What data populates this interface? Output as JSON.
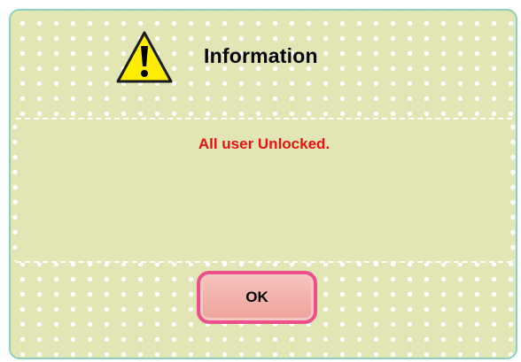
{
  "dialog": {
    "title": "Information",
    "message": "All user Unlocked.",
    "icon": "warning-icon",
    "ok_label": "OK"
  },
  "colors": {
    "background": "#e2e6b4",
    "dot": "#ffffff",
    "border": "#8fcfbf",
    "message_text": "#ee1111",
    "button_border": "#ee4f8a",
    "button_fill": "#f1aea7",
    "warning_yellow": "#ffee00"
  }
}
